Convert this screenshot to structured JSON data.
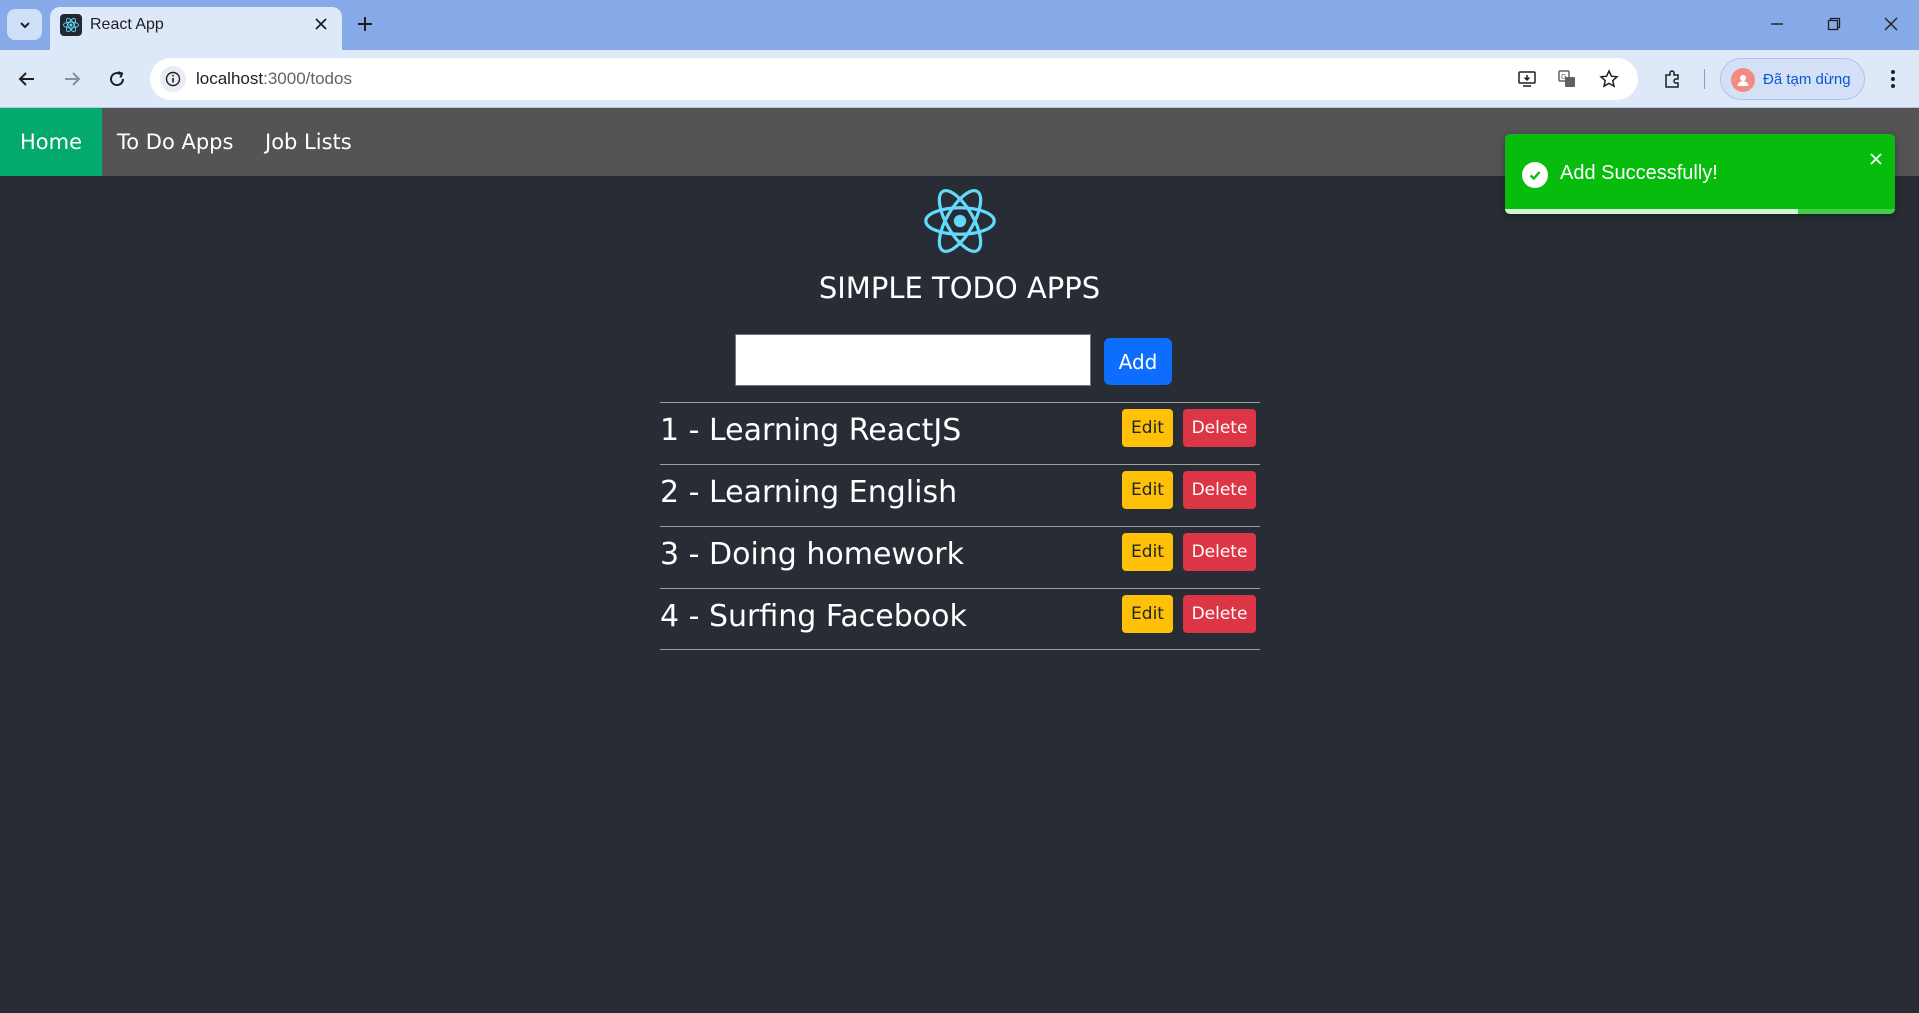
{
  "browser": {
    "tab_title": "React App",
    "url_host": "localhost",
    "url_path": ":3000/todos",
    "profile_label": "Đã tạm dừng"
  },
  "navbar": {
    "links": [
      {
        "label": "Home",
        "active": true
      },
      {
        "label": "To Do Apps",
        "active": false
      },
      {
        "label": "Job Lists",
        "active": false
      }
    ]
  },
  "app": {
    "title": "SIMPLE TODO APPS",
    "input_value": "",
    "add_label": "Add"
  },
  "todos": [
    {
      "text": "1 - Learning ReactJS",
      "edit_label": "Edit",
      "delete_label": "Delete"
    },
    {
      "text": "2 - Learning English",
      "edit_label": "Edit",
      "delete_label": "Delete"
    },
    {
      "text": "3 - Doing homework",
      "edit_label": "Edit",
      "delete_label": "Delete"
    },
    {
      "text": "4 - Surfing Facebook",
      "edit_label": "Edit",
      "delete_label": "Delete"
    }
  ],
  "toast": {
    "message": "Add Successfully!",
    "progress": 0.75,
    "color": "#07bc0c"
  },
  "colors": {
    "nav_active": "#04aa6d",
    "nav_bg": "#555455",
    "page_bg": "#282c34",
    "add_button": "#0d6efd",
    "edit_button": "#ffc107",
    "delete_button": "#dc3545",
    "react_logo": "#61dafb"
  }
}
